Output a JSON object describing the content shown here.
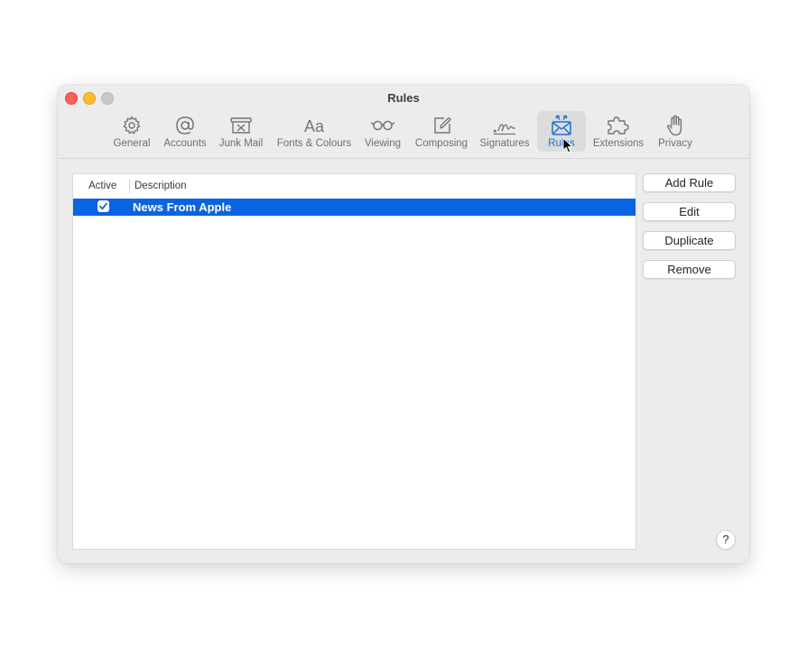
{
  "window": {
    "title": "Rules",
    "traffic_colors": {
      "close": "#fe5f57",
      "minimize": "#febc2e",
      "zoom": "#c8c8c8"
    }
  },
  "toolbar": {
    "selected": "Rules",
    "accent_color": "#1a6fd8",
    "tabs": [
      {
        "id": "general",
        "label": "General",
        "icon": "gear-icon"
      },
      {
        "id": "accounts",
        "label": "Accounts",
        "icon": "at-sign-icon"
      },
      {
        "id": "junk",
        "label": "Junk Mail",
        "icon": "junk-mail-icon"
      },
      {
        "id": "fonts",
        "label": "Fonts & Colours",
        "icon": "fonts-icon"
      },
      {
        "id": "viewing",
        "label": "Viewing",
        "icon": "glasses-icon"
      },
      {
        "id": "composing",
        "label": "Composing",
        "icon": "compose-icon"
      },
      {
        "id": "signatures",
        "label": "Signatures",
        "icon": "signature-icon"
      },
      {
        "id": "rules",
        "label": "Rules",
        "icon": "rules-envelope-icon"
      },
      {
        "id": "extensions",
        "label": "Extensions",
        "icon": "puzzle-icon"
      },
      {
        "id": "privacy",
        "label": "Privacy",
        "icon": "hand-icon"
      }
    ]
  },
  "rules_table": {
    "columns": {
      "active": "Active",
      "description": "Description"
    },
    "selection_color": "#0a63e0",
    "rows": [
      {
        "active": true,
        "description": "News From Apple",
        "selected": true
      }
    ]
  },
  "buttons": {
    "add_rule": "Add Rule",
    "edit": "Edit",
    "duplicate": "Duplicate",
    "remove": "Remove",
    "help": "?"
  }
}
